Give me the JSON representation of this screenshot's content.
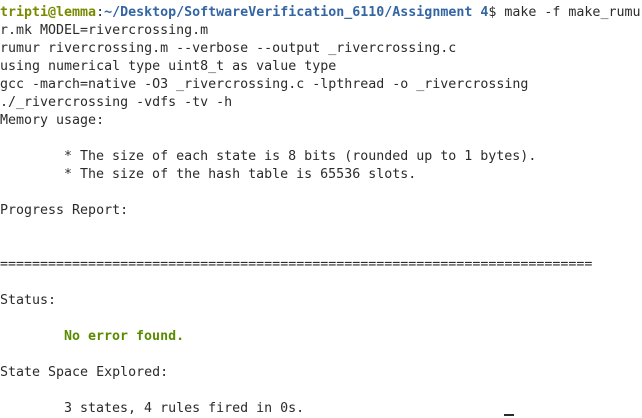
{
  "prompt": {
    "user_host": "tripti@lemma",
    "separator": ":",
    "path": "~/Desktop/SoftwareVerification_6110/Assignment 4",
    "symbol": "$ ",
    "command": "make -f make_rumu"
  },
  "output": [
    "r.mk MODEL=rivercrossing.m",
    "rumur rivercrossing.m --verbose --output _rivercrossing.c",
    "using numerical type uint8_t as value type",
    "gcc -march=native -O3 _rivercrossing.c -lpthread -o _rivercrossing",
    "./_rivercrossing -vdfs -tv -h",
    "Memory usage:",
    "",
    "* The size of each state is 8 bits (rounded up to 1 bytes).",
    "* The size of the hash table is 65536 slots.",
    "",
    "Progress Report:",
    "",
    "",
    "==========================================================================",
    "",
    "Status:",
    "",
    "No error found.",
    "",
    "State Space Explored:",
    "",
    "3 states, 4 rules fired in 0s."
  ]
}
